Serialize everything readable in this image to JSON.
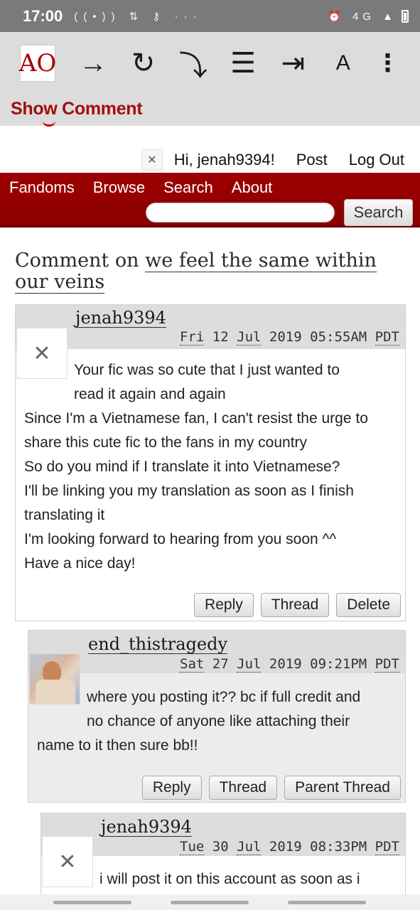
{
  "status_bar": {
    "time": "17:00",
    "left_icons": [
      "wifi-calling-icon",
      "data-transfer-icon",
      "key-icon",
      "more-dots"
    ],
    "left_symbols": "((•)) ⇅ ⚷ ···",
    "right_symbols": "⏰ 4G ▲",
    "right_icons": [
      "alarm-icon",
      "4g-icon",
      "signal-icon",
      "battery-icon"
    ]
  },
  "toolbar": {
    "icons": [
      "ao3-logo-icon",
      "forward-arrow-icon",
      "reload-icon",
      "step-over-icon",
      "list-icon",
      "indent-icon",
      "font-size-icon",
      "more-vert-icon"
    ],
    "logo_glyph": "AO",
    "forward_glyph": "→",
    "reload_glyph": "↻",
    "stepover_glyph": "⤵",
    "list_glyph": "☰",
    "indent_glyph": "⇥",
    "font_glyph": "A",
    "more_glyph": "⋮"
  },
  "show_comment_label": "Show Comment",
  "user_nav": {
    "greeting": "Hi, jenah9394!",
    "post": "Post",
    "logout": "Log Out"
  },
  "main_nav": {
    "items": [
      "Fandoms",
      "Browse",
      "Search",
      "About"
    ],
    "search_placeholder": "",
    "search_button": "Search"
  },
  "heading": {
    "prefix": "Comment on ",
    "work_title": "we feel the same within our veins"
  },
  "comments": [
    {
      "username": "jenah9394",
      "date_day": "Fri",
      "date_date": "12",
      "date_month": "Jul",
      "date_year": "2019",
      "date_time": "05:55AM",
      "date_tz": "PDT",
      "lines": [
        "Your fic was so cute that I just wanted to",
        "read it again and again",
        "Since I'm a Vietnamese fan, I can't resist the urge to",
        "share this cute fic to the fans in my country",
        "So do you mind if I translate it into Vietnamese?",
        "I'll be linking you my translation as soon as I finish",
        "translating it",
        "I'm looking forward to hearing from you soon ^^",
        "Have a nice day!"
      ],
      "actions": [
        "Reply",
        "Thread",
        "Delete"
      ]
    },
    {
      "username": "end_thistragedy",
      "date_day": "Sat",
      "date_date": "27",
      "date_month": "Jul",
      "date_year": "2019",
      "date_time": "09:21PM",
      "date_tz": "PDT",
      "lines": [
        "where you posting it?? bc if full credit and",
        "no chance of anyone like attaching their",
        "name to it then sure bb!!"
      ],
      "actions": [
        "Reply",
        "Thread",
        "Parent Thread"
      ]
    },
    {
      "username": "jenah9394",
      "date_day": "Tue",
      "date_date": "30",
      "date_month": "Jul",
      "date_year": "2019",
      "date_time": "08:33PM",
      "date_tz": "PDT",
      "lines": [
        "i will post it on this account as soon as i"
      ]
    }
  ],
  "colors": {
    "brand_red": "#990000",
    "toolbar_gray": "#dcdcdc",
    "status_gray": "#7a7a7a"
  }
}
